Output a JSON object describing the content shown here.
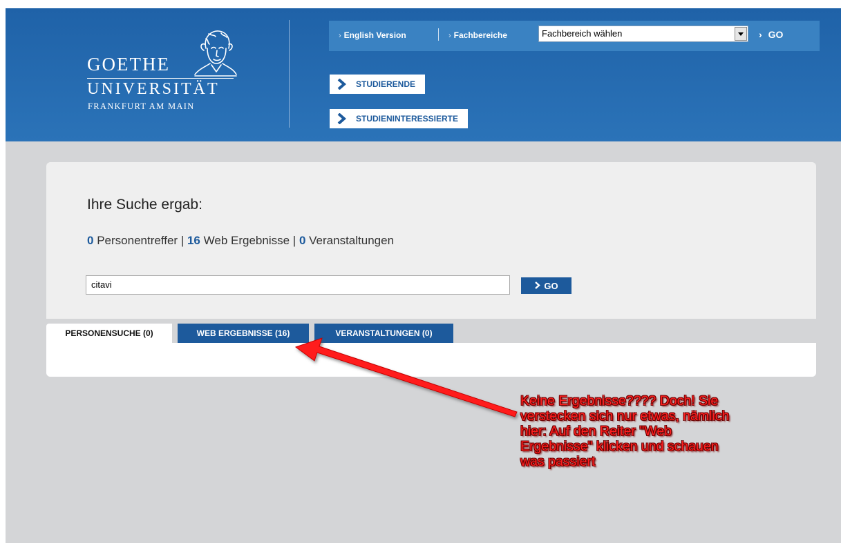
{
  "header": {
    "logo": {
      "line1": "GOETHE",
      "line2": "UNIVERSITÄT",
      "line3": "FRANKFURT AM MAIN"
    },
    "topbar": {
      "english_link": "English Version",
      "fachbereiche_link": "Fachbereiche",
      "select_value": "Fachbereich wählen",
      "go_label": "GO"
    },
    "nav": {
      "studierende": "STUDIERENDE",
      "studieninteressierte": "STUDIENINTERESSIERTE"
    }
  },
  "search": {
    "title": "Ihre Suche ergab:",
    "counts": {
      "persons_num": "0",
      "persons_label": "Personentreffer",
      "web_num": "16",
      "web_label": "Web Ergebnisse",
      "events_num": "0",
      "events_label": "Veranstaltungen",
      "separator": "|"
    },
    "query": "citavi",
    "go_label": "GO",
    "tabs": [
      {
        "label": "PERSONENSUCHE (0)",
        "active": true
      },
      {
        "label": "WEB ERGEBNISSE (16)",
        "active": false
      },
      {
        "label": "VERANSTALTUNGEN (0)",
        "active": false
      }
    ]
  },
  "annotation": {
    "lines": [
      "Keine Ergebnisse???? Doch! Sie",
      "verstecken sich nur  etwas, nämlich",
      "hier: Auf den Reiter \"Web",
      "Ergebnisse\" klicken und schauen",
      "was passiert"
    ],
    "color": "#ff2020"
  },
  "colors": {
    "header_blue": "#1f62a8",
    "accent_blue": "#1d5a9c",
    "page_gray": "#d4d5d7"
  }
}
